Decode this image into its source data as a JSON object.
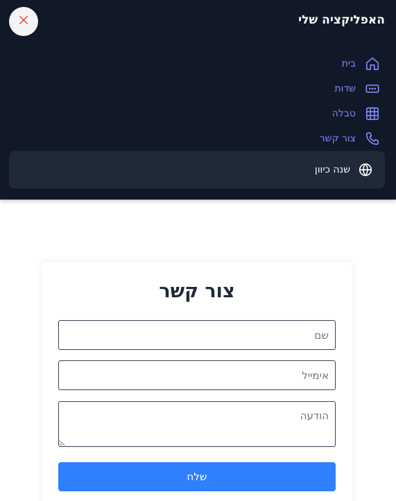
{
  "app": {
    "title": "האפליקציה שלי"
  },
  "nav": {
    "items": [
      {
        "label": "בית",
        "icon": "home-icon"
      },
      {
        "label": "שדות",
        "icon": "input-fields-icon"
      },
      {
        "label": "טבלה",
        "icon": "table-grid-icon"
      },
      {
        "label": "צור קשר",
        "icon": "phone-icon"
      }
    ],
    "language_toggle": {
      "label": "שנה כיוון",
      "icon": "globe-icon"
    },
    "close": {
      "icon": "close-icon"
    }
  },
  "contact_form": {
    "title": "צור קשר",
    "name_placeholder": "שם",
    "email_placeholder": "אימייל",
    "message_placeholder": "הודעה",
    "submit_label": "שלח"
  },
  "colors": {
    "nav_background": "#111827",
    "nav_link": "#818cf8",
    "close_icon": "#ef4444",
    "primary_button": "#2f80ff"
  }
}
